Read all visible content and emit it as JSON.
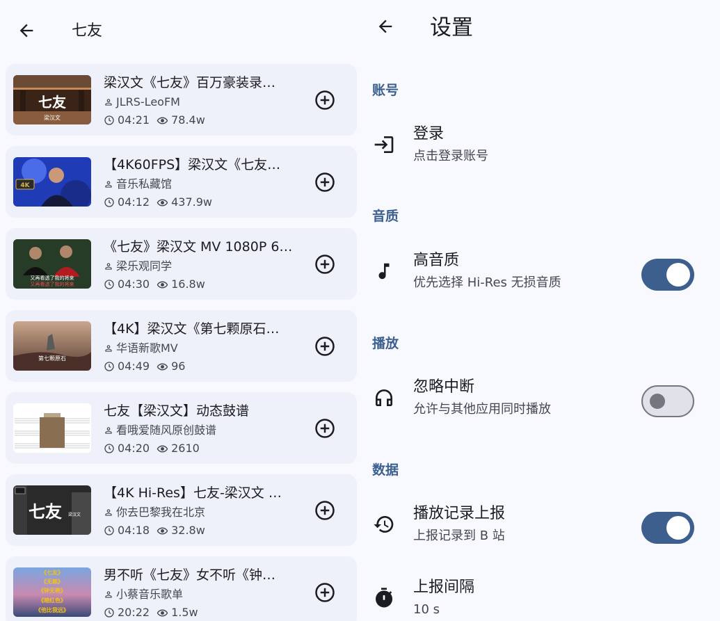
{
  "left_panel": {
    "title": "七友",
    "videos": [
      {
        "title": "梁汉文《七友》百万豪装录…",
        "author": "JLRS-LeoFM",
        "duration": "04:21",
        "views": "78.4w",
        "thumb_text": "七友",
        "thumb_sub": "梁汉文"
      },
      {
        "title": "【4K60FPS】梁汉文《七友…",
        "author": "音乐私藏馆",
        "duration": "04:12",
        "views": "437.9w",
        "thumb_text": "4K",
        "thumb_sub": ""
      },
      {
        "title": "《七友》梁汉文 MV 1080P 6…",
        "author": "梁乐观同学",
        "duration": "04:30",
        "views": "16.8w",
        "thumb_text": "又再看透了我的将来",
        "thumb_sub": "又再看透了我的将来"
      },
      {
        "title": "【4K】梁汉文《第七颗原石…",
        "author": "华语新歌MV",
        "duration": "04:49",
        "views": "96",
        "thumb_text": "第七颗原石",
        "thumb_sub": ""
      },
      {
        "title": "七友【梁汉文】动态鼓谱",
        "author": "看哦爱随风原创鼓谱",
        "duration": "04:20",
        "views": "2610",
        "thumb_text": "",
        "thumb_sub": ""
      },
      {
        "title": "【4K Hi-Res】七友-梁汉文 …",
        "author": "你去巴黎我在北京",
        "duration": "04:18",
        "views": "32.8w",
        "thumb_text": "七友",
        "thumb_sub": "梁汉文"
      },
      {
        "title": "男不听《七友》女不听《钟…",
        "author": "小蔡音乐歌单",
        "duration": "20:22",
        "views": "1.5w",
        "thumb_text": "《七友》",
        "thumb_lines": [
          "《七友》",
          "《无赖》",
          "《钟无艳》",
          "《暗红色》",
          "《他比我远》"
        ],
        "thumb_sub": ""
      }
    ]
  },
  "right_panel": {
    "title": "设置",
    "sections": {
      "account": "账号",
      "quality": "音质",
      "playback": "播放",
      "data": "数据"
    },
    "items": {
      "login": {
        "title": "登录",
        "subtitle": "点击登录账号"
      },
      "hires": {
        "title": "高音质",
        "subtitle": "优先选择 Hi-Res 无损音质",
        "enabled": true
      },
      "ignore_interrupt": {
        "title": "忽略中断",
        "subtitle": "允许与其他应用同时播放",
        "enabled": false
      },
      "report_history": {
        "title": "播放记录上报",
        "subtitle": "上报记录到 B 站",
        "enabled": true
      },
      "report_interval": {
        "title": "上报间隔",
        "subtitle": "10 s"
      }
    }
  },
  "colors": {
    "accent": "#3c5f8e",
    "background": "#f7f9ff",
    "card": "#eef1f9"
  }
}
